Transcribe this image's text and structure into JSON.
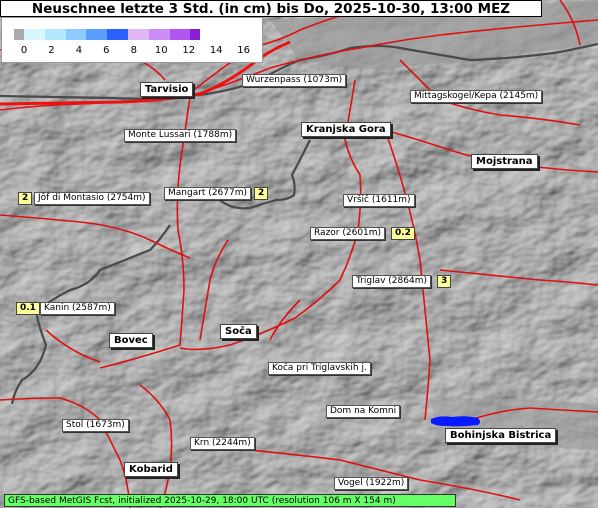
{
  "title": "Neuschnee letzte 3 Std. (in cm) bis Do, 2025-10-30, 13:00 MEZ",
  "legend": {
    "ticks": [
      "0",
      "2",
      "4",
      "6",
      "8",
      "10",
      "12",
      "14",
      "16"
    ],
    "colors": [
      "#aaaaaa",
      "#d9f7ff",
      "#b0e8ff",
      "#8ccaff",
      "#5a9eff",
      "#2a60ff",
      "#e0b8f7",
      "#cc8cf5",
      "#b055ee",
      "#8a1ed6"
    ]
  },
  "peaks": [
    {
      "key": "wurzenpass",
      "label": "Wurzenpass (1073m)"
    },
    {
      "key": "mittagskogel",
      "label": "Mittagskogel/Kepa (2145m)"
    },
    {
      "key": "lussari",
      "label": "Monte Lussari (1788m)"
    },
    {
      "key": "jof",
      "label": "Jôf di Montasio (2754m)"
    },
    {
      "key": "mangart",
      "label": "Mangart (2677m)"
    },
    {
      "key": "vrsic",
      "label": "Vršič (1611m)"
    },
    {
      "key": "razor",
      "label": "Razor (2601m)"
    },
    {
      "key": "triglav",
      "label": "Triglav (2864m)"
    },
    {
      "key": "kanin",
      "label": "Kanin (2587m)"
    },
    {
      "key": "koca",
      "label": "Koča pri Triglavskih j."
    },
    {
      "key": "komni",
      "label": "Dom na Komni"
    },
    {
      "key": "stol",
      "label": "Stol (1673m)"
    },
    {
      "key": "krn",
      "label": "Krn (2244m)"
    },
    {
      "key": "vogel",
      "label": "Vogel (1922m)"
    }
  ],
  "towns": [
    {
      "key": "tarvisio",
      "label": "Tarvisio"
    },
    {
      "key": "kranjska",
      "label": "Kranjska Gora"
    },
    {
      "key": "mojstrana",
      "label": "Mojstrana"
    },
    {
      "key": "bovec",
      "label": "Bovec"
    },
    {
      "key": "soca",
      "label": "Soča"
    },
    {
      "key": "bohinjska",
      "label": "Bohinjska Bistrica"
    },
    {
      "key": "kobarid",
      "label": "Kobarid"
    }
  ],
  "values": [
    {
      "key": "jof",
      "value": "2"
    },
    {
      "key": "mangart",
      "value": "2"
    },
    {
      "key": "razor",
      "value": "0.2"
    },
    {
      "key": "triglav",
      "value": "3"
    },
    {
      "key": "kanin",
      "value": "0.1"
    }
  ],
  "footer": "GFS-based MetGIS Fcst, initialized 2025-10-29, 18:00 UTC  (resolution 106 m X 154 m)"
}
